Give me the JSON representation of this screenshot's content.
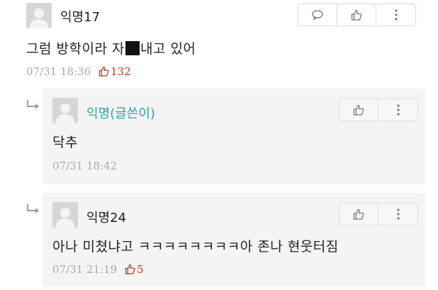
{
  "comments": [
    {
      "author": "익명17",
      "text_before": "그럼 방학이라 자",
      "text_after": "내고 있어",
      "timestamp": "07/31 18:36",
      "likes": "132"
    },
    {
      "author": "익명(글쓴이)",
      "text": "닥추",
      "timestamp": "07/31 18:42"
    },
    {
      "author": "익명24",
      "text": "아나 미쳤냐고 ㅋㅋㅋㅋㅋㅋㅋㅋ아 존나 현웃터짐",
      "timestamp": "07/31 21:19",
      "likes": "5"
    }
  ],
  "icons": {
    "reply": "speech-bubble-icon",
    "like": "thumbs-up-icon",
    "more": "vertical-dots-icon",
    "reply_indicator": "reply-arrow-icon",
    "avatar": "default-avatar"
  },
  "colors": {
    "op_name": "#2aa5a0",
    "likes": "#c0392b",
    "meta": "#a9a9a9",
    "reply_bg": "#f4f4f4"
  }
}
